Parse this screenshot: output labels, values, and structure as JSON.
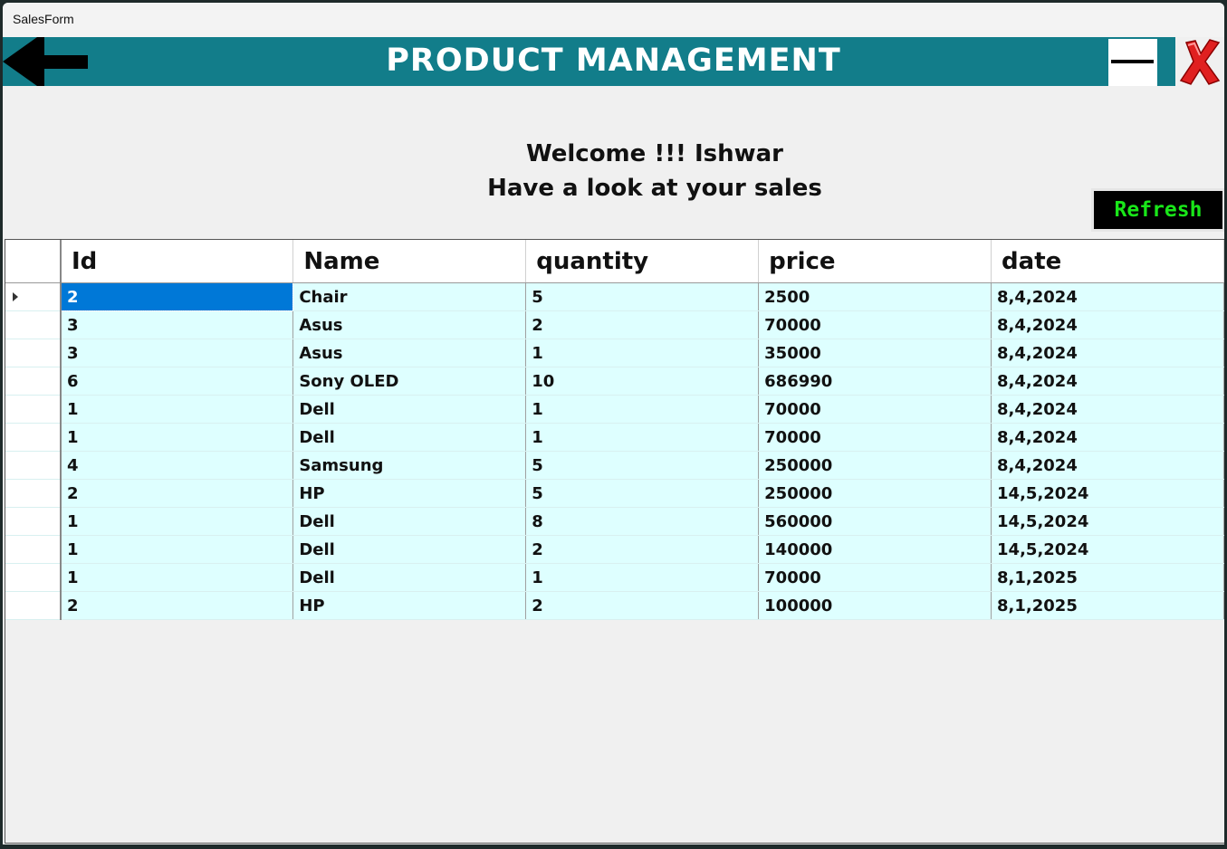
{
  "window": {
    "title": "SalesForm"
  },
  "header": {
    "title": "PRODUCT MANAGEMENT"
  },
  "welcome": {
    "line1": "Welcome !!! Ishwar",
    "line2": "Have a look at your sales"
  },
  "refresh_label": "Refresh",
  "colors": {
    "header_bg": "#127d8a",
    "row_bg": "#deffff",
    "selection": "#0078d7",
    "refresh_text": "#19e619"
  },
  "table": {
    "columns": [
      "Id",
      "Name",
      "quantity",
      "price",
      "date"
    ],
    "rows": [
      [
        "2",
        "Chair",
        "5",
        "2500",
        "8,4,2024"
      ],
      [
        "3",
        "Asus",
        "2",
        "70000",
        "8,4,2024"
      ],
      [
        "3",
        "Asus",
        "1",
        "35000",
        "8,4,2024"
      ],
      [
        "6",
        "Sony OLED",
        "10",
        "686990",
        "8,4,2024"
      ],
      [
        "1",
        "Dell",
        "1",
        "70000",
        "8,4,2024"
      ],
      [
        "1",
        "Dell",
        "1",
        "70000",
        "8,4,2024"
      ],
      [
        "4",
        "Samsung",
        "5",
        "250000",
        "8,4,2024"
      ],
      [
        "2",
        "HP",
        "5",
        "250000",
        "14,5,2024"
      ],
      [
        "1",
        "Dell",
        "8",
        "560000",
        "14,5,2024"
      ],
      [
        "1",
        "Dell",
        "2",
        "140000",
        "14,5,2024"
      ],
      [
        "1",
        "Dell",
        "1",
        "70000",
        "8,1,2025"
      ],
      [
        "2",
        "HP",
        "2",
        "100000",
        "8,1,2025"
      ]
    ]
  },
  "icons": {
    "back": "back-arrow-icon",
    "minimize": "minimize-icon",
    "close": "close-x-icon",
    "current_row": "row-pointer-icon"
  }
}
